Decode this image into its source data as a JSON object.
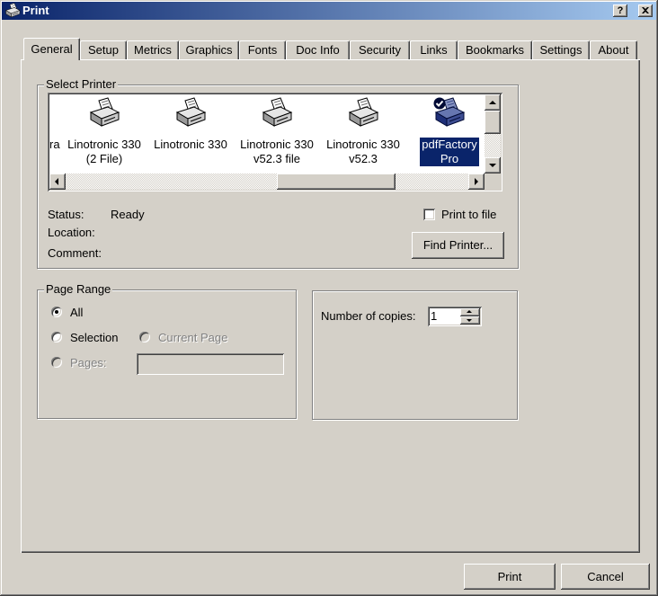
{
  "window": {
    "title": "Print",
    "help_label": "?"
  },
  "icons": {
    "title": "printer-icon",
    "printer": "printer-icon",
    "default_printer": "check-circle-icon",
    "close": "close-icon"
  },
  "colors": {
    "title_bar_start": "#0a246a",
    "title_bar_end": "#a6caf0",
    "selection": "#0a246a",
    "face": "#d4d0c8"
  },
  "tabs": [
    {
      "label": "General",
      "selected": true
    },
    {
      "label": "Setup"
    },
    {
      "label": "Metrics"
    },
    {
      "label": "Graphics"
    },
    {
      "label": "Fonts"
    },
    {
      "label": "Doc Info"
    },
    {
      "label": "Security"
    },
    {
      "label": "Links"
    },
    {
      "label": "Bookmarks"
    },
    {
      "label": "Settings"
    },
    {
      "label": "About"
    }
  ],
  "select_printer": {
    "legend": "Select Printer",
    "printers": [
      {
        "line1": "ra"
      },
      {
        "line1": "Linotronic 330",
        "line2": "(2 File)"
      },
      {
        "line1": "Linotronic 330"
      },
      {
        "line1": "Linotronic 330",
        "line2": "v52.3 file"
      },
      {
        "line1": "Linotronic 330",
        "line2": "v52.3"
      },
      {
        "line1": "pdfFactory",
        "line2": "Pro",
        "selected": true,
        "default": true
      }
    ],
    "status_label": "Status:",
    "status_value": "Ready",
    "location_label": "Location:",
    "comment_label": "Comment:",
    "print_to_file_label": "Print to file",
    "print_to_file_checked": false,
    "find_printer_label": "Find Printer..."
  },
  "page_range": {
    "legend": "Page Range",
    "all_label": "All",
    "selection_label": "Selection",
    "current_page_label": "Current Page",
    "pages_label": "Pages:",
    "selected": "all"
  },
  "copies": {
    "label": "Number of copies:",
    "value": "1"
  },
  "buttons": {
    "print": "Print",
    "cancel": "Cancel"
  }
}
